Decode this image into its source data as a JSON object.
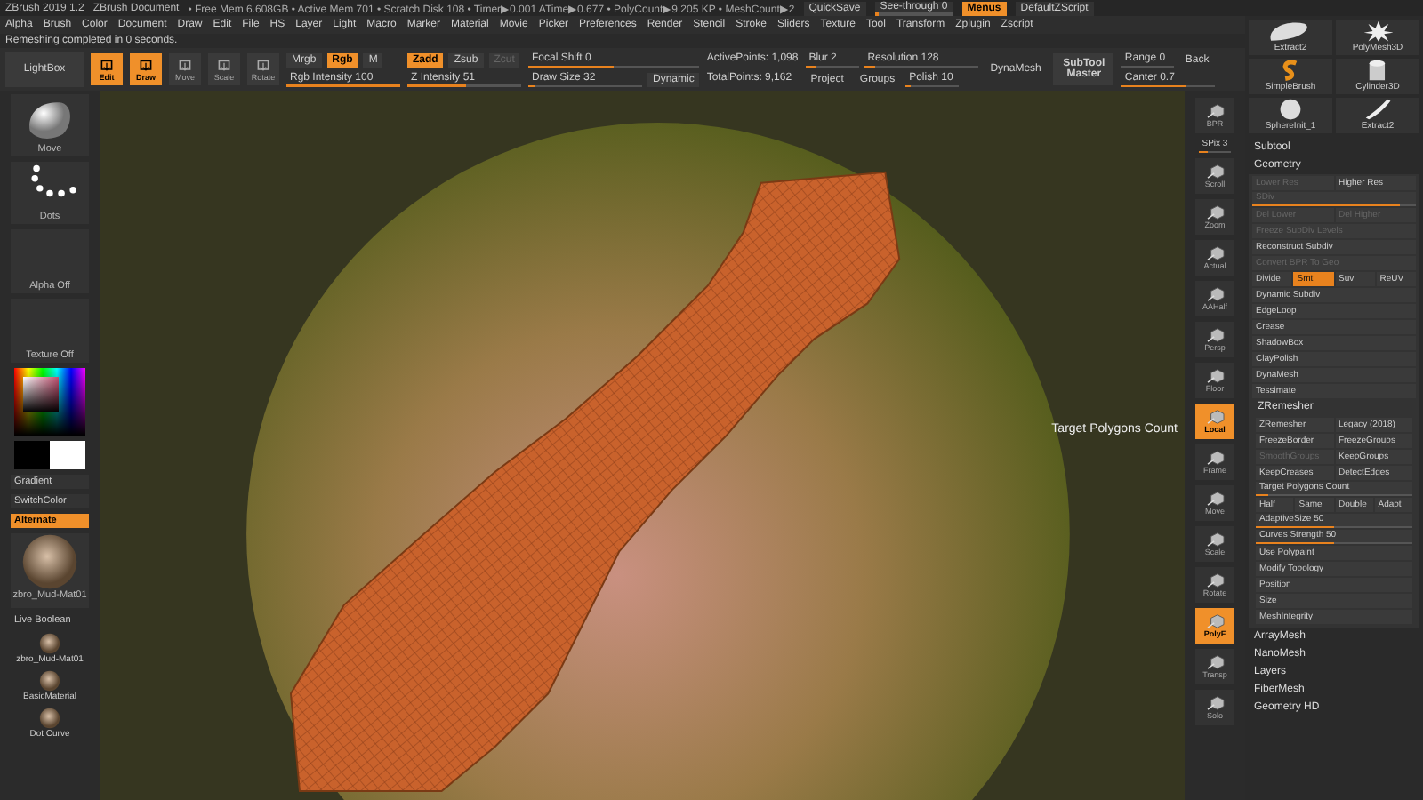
{
  "title_bar": {
    "app": "ZBrush 2019 1.2",
    "document": "ZBrush Document",
    "stats": "• Free Mem 6.608GB • Active Mem 701 • Scratch Disk 108 • Timer▶0.001 ATime▶0.677 • PolyCount▶9.205 KP • MeshCount▶2",
    "quicksave": "QuickSave",
    "see_through": {
      "label": "See-through 0",
      "level": 0.05
    },
    "menus": {
      "label": "Menus",
      "on": true
    },
    "script": "DefaultZScript"
  },
  "menu": [
    "Alpha",
    "Brush",
    "Color",
    "Document",
    "Draw",
    "Edit",
    "File",
    "HS",
    "Layer",
    "Light",
    "Macro",
    "Marker",
    "Material",
    "Movie",
    "Picker",
    "Preferences",
    "Render",
    "Stencil",
    "Stroke",
    "Sliders",
    "Texture",
    "Tool",
    "Transform",
    "Zplugin",
    "Zscript"
  ],
  "status": "Remeshing completed in 0 seconds.",
  "shelf": {
    "lightbox": "LightBox",
    "modes": [
      {
        "label": "Edit",
        "selected": true
      },
      {
        "label": "Draw",
        "selected": true
      },
      {
        "label": "Move",
        "selected": false
      },
      {
        "label": "Scale",
        "selected": false
      },
      {
        "label": "Rotate",
        "selected": false
      }
    ],
    "rgb_buttons": [
      {
        "label": "Mrgb",
        "selected": false,
        "disabled": false
      },
      {
        "label": "Rgb",
        "selected": true,
        "disabled": false
      },
      {
        "label": "M",
        "selected": false,
        "disabled": false
      }
    ],
    "z_buttons": [
      {
        "label": "Zadd",
        "selected": true,
        "disabled": false
      },
      {
        "label": "Zsub",
        "selected": false,
        "disabled": false
      },
      {
        "label": "Zcut",
        "selected": false,
        "disabled": true
      }
    ],
    "rgb_intensity": {
      "label": "Rgb Intensity",
      "value": "100",
      "level": 1
    },
    "z_intensity": {
      "label": "Z Intensity",
      "value": "51",
      "level": 0.51
    },
    "focal_shift": {
      "label": "Focal Shift",
      "value": "0",
      "level": 0.5
    },
    "draw_size": {
      "label": "Draw Size",
      "value": "32",
      "level": 0.06
    },
    "dynamic": "Dynamic",
    "active_points": "ActivePoints: 1,098",
    "total_points": "TotalPoints: 9,162",
    "blur": {
      "label": "Blur",
      "value": "2",
      "level": 0.2
    },
    "resolution": {
      "label": "Resolution",
      "value": "128",
      "level": 0.1
    },
    "project": "Project",
    "groups": "Groups",
    "polish": {
      "label": "Polish",
      "value": "10",
      "level": 0.1
    },
    "dynamesh": "DynaMesh",
    "subtool_master": "SubTool Master",
    "range": {
      "label": "Range 0",
      "level": 0
    },
    "back": "Back",
    "canter": {
      "label": "Canter 0.7",
      "level": 0.7
    }
  },
  "left_shelf": {
    "brush": "Move",
    "stroke": "Dots",
    "alpha": "Alpha Off",
    "texture": "Texture Off",
    "gradient": "Gradient",
    "switch_color": "SwitchColor",
    "alternate": {
      "label": "Alternate",
      "on": true
    },
    "material": "zbro_Mud-Mat01",
    "live_boolean": "Live Boolean",
    "materials": [
      "zbro_Mud-Mat01",
      "BasicMaterial",
      "Dot Curve"
    ]
  },
  "canvas": {
    "tooltip": "Target Polygons Count"
  },
  "view_tools": [
    {
      "kind": "icon",
      "label": "BPR",
      "selected": false
    },
    {
      "kind": "slider",
      "label": "SPix 3",
      "level": 0.3
    },
    {
      "kind": "icon",
      "label": "Scroll",
      "selected": false
    },
    {
      "kind": "icon",
      "label": "Zoom",
      "selected": false
    },
    {
      "kind": "icon",
      "label": "Actual",
      "selected": false
    },
    {
      "kind": "icon",
      "label": "AAHalf",
      "selected": false
    },
    {
      "kind": "icon",
      "label": "Persp",
      "selected": false
    },
    {
      "kind": "icon",
      "label": "Floor",
      "selected": false
    },
    {
      "kind": "icon",
      "label": "Local",
      "selected": true
    },
    {
      "kind": "icon",
      "label": "Frame",
      "selected": false
    },
    {
      "kind": "icon",
      "label": "Move",
      "selected": false
    },
    {
      "kind": "icon",
      "label": "Scale",
      "selected": false
    },
    {
      "kind": "icon",
      "label": "Rotate",
      "selected": false
    },
    {
      "kind": "icon",
      "label": "PolyF",
      "selected": true
    },
    {
      "kind": "icon",
      "label": "Transp",
      "selected": false
    },
    {
      "kind": "icon",
      "label": "Solo",
      "selected": false
    }
  ],
  "tool_thumbs": [
    {
      "kind": "blob",
      "label": "Extract2"
    },
    {
      "kind": "star",
      "label": "PolyMesh3D"
    },
    {
      "kind": "s",
      "label": "SimpleBrush"
    },
    {
      "kind": "cylinder",
      "label": "Cylinder3D"
    },
    {
      "kind": "sphere",
      "label": "SphereInit_1"
    },
    {
      "kind": "strip",
      "label": "Extract2"
    }
  ],
  "tool_panel": [
    {
      "kind": "section",
      "label": "Subtool"
    },
    {
      "kind": "section",
      "label": "Geometry",
      "children": [
        {
          "kind": "row",
          "items": [
            {
              "label": "Lower Res",
              "disabled": true
            },
            {
              "label": "Higher Res",
              "disabled": false
            }
          ]
        },
        {
          "kind": "slider",
          "label": "SDiv",
          "level": 0.9,
          "disabled": true
        },
        {
          "kind": "row",
          "items": [
            {
              "label": "Del Lower",
              "disabled": true
            },
            {
              "label": "Del Higher",
              "disabled": true
            }
          ]
        },
        {
          "kind": "button",
          "label": "Freeze SubDiv Levels",
          "disabled": true
        },
        {
          "kind": "button",
          "label": "Reconstruct Subdiv",
          "disabled": false
        },
        {
          "kind": "button",
          "label": "Convert BPR To Geo",
          "disabled": true
        },
        {
          "kind": "row",
          "items": [
            {
              "label": "Divide",
              "disabled": false,
              "selected": false
            },
            {
              "label": "Smt",
              "disabled": false,
              "selected": true
            },
            {
              "label": "Suv",
              "disabled": false,
              "selected": false
            },
            {
              "label": "ReUV",
              "disabled": false,
              "selected": false
            }
          ]
        },
        {
          "kind": "button",
          "label": "Dynamic Subdiv",
          "disabled": false
        },
        {
          "kind": "button",
          "label": "EdgeLoop",
          "disabled": false
        },
        {
          "kind": "button",
          "label": "Crease",
          "disabled": false
        },
        {
          "kind": "button",
          "label": "ShadowBox",
          "disabled": false
        },
        {
          "kind": "button",
          "label": "ClayPolish",
          "disabled": false
        },
        {
          "kind": "button",
          "label": "DynaMesh",
          "disabled": false
        },
        {
          "kind": "button",
          "label": "Tessimate",
          "disabled": false
        },
        {
          "kind": "section",
          "label": "ZRemesher",
          "children": [
            {
              "kind": "row",
              "items": [
                {
                  "label": "ZRemesher",
                  "disabled": false
                },
                {
                  "label": "Legacy (2018)",
                  "disabled": false
                }
              ]
            },
            {
              "kind": "row",
              "items": [
                {
                  "label": "FreezeBorder",
                  "disabled": false
                },
                {
                  "label": "FreezeGroups",
                  "disabled": false
                }
              ]
            },
            {
              "kind": "row",
              "items": [
                {
                  "label": "SmoothGroups",
                  "disabled": true
                },
                {
                  "label": "KeepGroups",
                  "disabled": false
                }
              ]
            },
            {
              "kind": "row",
              "items": [
                {
                  "label": "KeepCreases",
                  "disabled": false
                },
                {
                  "label": "DetectEdges",
                  "disabled": false
                }
              ]
            },
            {
              "kind": "slider",
              "label": "Target Polygons Count",
              "level": 0.08,
              "disabled": false
            },
            {
              "kind": "row",
              "items": [
                {
                  "label": "Half",
                  "disabled": false
                },
                {
                  "label": "Same",
                  "disabled": false
                },
                {
                  "label": "Double",
                  "disabled": false
                },
                {
                  "label": "Adapt",
                  "disabled": false
                }
              ]
            },
            {
              "kind": "slider",
              "label": "AdaptiveSize",
              "value": "50",
              "level": 0.5,
              "disabled": false
            },
            {
              "kind": "slider",
              "label": "Curves Strength",
              "value": "50",
              "level": 0.5,
              "disabled": false
            },
            {
              "kind": "button",
              "label": "Use Polypaint",
              "disabled": false
            },
            {
              "kind": "button",
              "label": "Modify Topology",
              "disabled": false
            },
            {
              "kind": "button",
              "label": "Position",
              "disabled": false
            },
            {
              "kind": "button",
              "label": "Size",
              "disabled": false
            },
            {
              "kind": "button",
              "label": "MeshIntegrity",
              "disabled": false
            }
          ]
        }
      ]
    },
    {
      "kind": "section",
      "label": "ArrayMesh"
    },
    {
      "kind": "section",
      "label": "NanoMesh"
    },
    {
      "kind": "section",
      "label": "Layers"
    },
    {
      "kind": "section",
      "label": "FiberMesh"
    },
    {
      "kind": "section",
      "label": "Geometry HD"
    }
  ]
}
